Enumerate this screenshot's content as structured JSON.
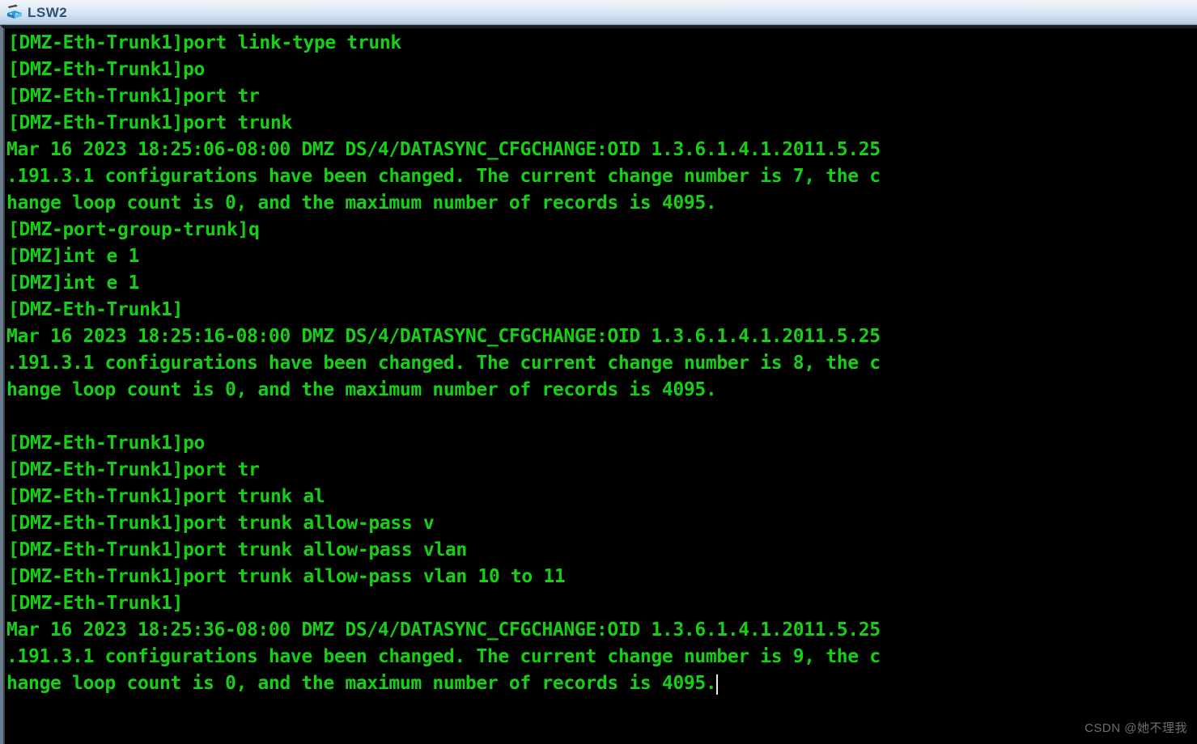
{
  "window": {
    "title": "LSW2",
    "icon": "network-switch-icon",
    "titlebar_gradient_top": "#f2f6fb",
    "titlebar_gradient_bottom": "#a8c3dd",
    "title_color": "#2d4f80"
  },
  "terminal": {
    "background": "#000000",
    "foreground": "#17cf17",
    "cursor_color": "#e8e8e8",
    "font_size_px": 23,
    "line_height_px": 33,
    "lines": [
      {
        "type": "prompt",
        "text": "[DMZ-Eth-Trunk1]port link-type trunk"
      },
      {
        "type": "prompt",
        "text": "[DMZ-Eth-Trunk1]po"
      },
      {
        "type": "prompt",
        "text": "[DMZ-Eth-Trunk1]port tr"
      },
      {
        "type": "prompt",
        "text": "[DMZ-Eth-Trunk1]port trunk"
      },
      {
        "type": "log",
        "text": "Mar 16 2023 18:25:06-08:00 DMZ DS/4/DATASYNC_CFGCHANGE:OID 1.3.6.1.4.1.2011.5.25"
      },
      {
        "type": "log",
        "text": ".191.3.1 configurations have been changed. The current change number is 7, the c"
      },
      {
        "type": "log",
        "text": "hange loop count is 0, and the maximum number of records is 4095."
      },
      {
        "type": "prompt",
        "text": "[DMZ-port-group-trunk]q"
      },
      {
        "type": "prompt",
        "text": "[DMZ]int e 1"
      },
      {
        "type": "prompt",
        "text": "[DMZ]int e 1"
      },
      {
        "type": "prompt",
        "text": "[DMZ-Eth-Trunk1]"
      },
      {
        "type": "log",
        "text": "Mar 16 2023 18:25:16-08:00 DMZ DS/4/DATASYNC_CFGCHANGE:OID 1.3.6.1.4.1.2011.5.25"
      },
      {
        "type": "log",
        "text": ".191.3.1 configurations have been changed. The current change number is 8, the c"
      },
      {
        "type": "log",
        "text": "hange loop count is 0, and the maximum number of records is 4095."
      },
      {
        "type": "blank",
        "text": ""
      },
      {
        "type": "prompt",
        "text": "[DMZ-Eth-Trunk1]po"
      },
      {
        "type": "prompt",
        "text": "[DMZ-Eth-Trunk1]port tr"
      },
      {
        "type": "prompt",
        "text": "[DMZ-Eth-Trunk1]port trunk al"
      },
      {
        "type": "prompt",
        "text": "[DMZ-Eth-Trunk1]port trunk allow-pass v"
      },
      {
        "type": "prompt",
        "text": "[DMZ-Eth-Trunk1]port trunk allow-pass vlan"
      },
      {
        "type": "prompt",
        "text": "[DMZ-Eth-Trunk1]port trunk allow-pass vlan 10 to 11"
      },
      {
        "type": "prompt",
        "text": "[DMZ-Eth-Trunk1]"
      },
      {
        "type": "log",
        "text": "Mar 16 2023 18:25:36-08:00 DMZ DS/4/DATASYNC_CFGCHANGE:OID 1.3.6.1.4.1.2011.5.25"
      },
      {
        "type": "log",
        "text": ".191.3.1 configurations have been changed. The current change number is 9, the c"
      },
      {
        "type": "log",
        "text": "hange loop count is 0, and the maximum number of records is 4095."
      }
    ],
    "cursor": {
      "line_index": 24,
      "column": 65
    }
  },
  "watermark": {
    "text": "CSDN @她不理我",
    "color": "#6f6f6f"
  }
}
